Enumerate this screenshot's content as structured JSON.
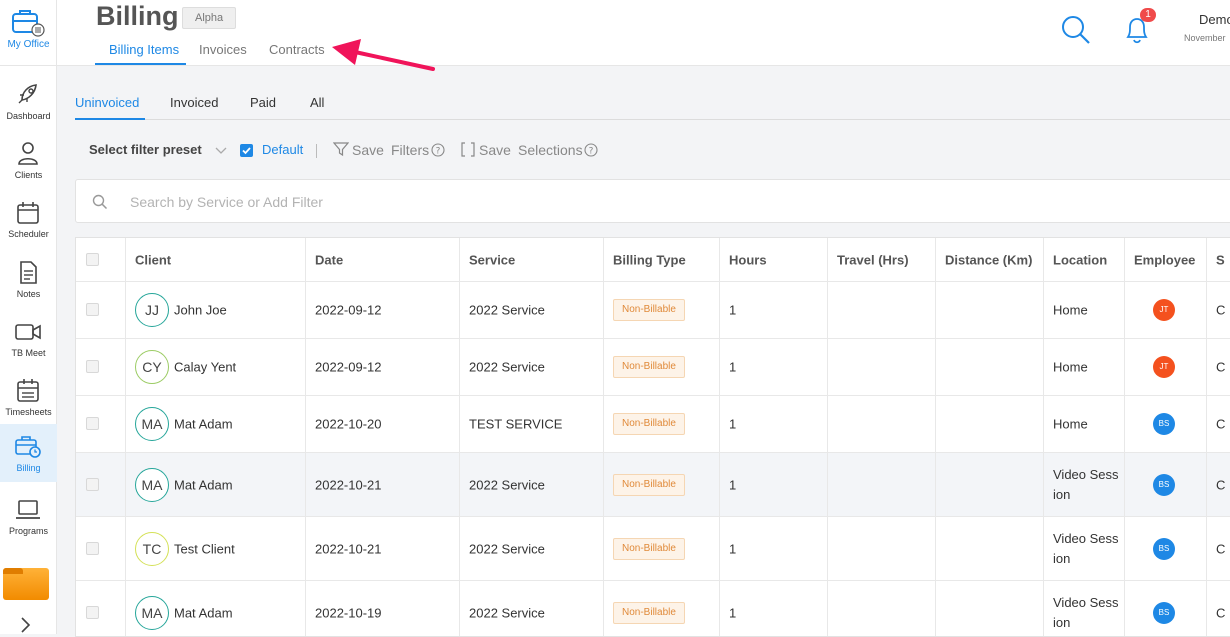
{
  "rail": {
    "office_label": "My Office",
    "items": [
      {
        "label": "Dashboard",
        "icon": "rocket-icon"
      },
      {
        "label": "Clients",
        "icon": "person-icon"
      },
      {
        "label": "Scheduler",
        "icon": "calendar-icon"
      },
      {
        "label": "Notes",
        "icon": "document-icon"
      },
      {
        "label": "TB Meet",
        "icon": "video-icon"
      },
      {
        "label": "Timesheets",
        "icon": "timesheet-icon"
      },
      {
        "label": "Billing",
        "icon": "billing-icon",
        "active": true
      },
      {
        "label": "Programs",
        "icon": "laptop-icon"
      }
    ]
  },
  "header": {
    "title": "Billing",
    "badge": "Alpha",
    "tabs": [
      {
        "label": "Billing Items",
        "active": true
      },
      {
        "label": "Invoices"
      },
      {
        "label": "Contracts"
      }
    ],
    "notification_count": "1",
    "user_name": "Demo",
    "user_sub": "November"
  },
  "subtabs": [
    {
      "label": "Uninvoiced",
      "active": true
    },
    {
      "label": "Invoiced"
    },
    {
      "label": "Paid"
    },
    {
      "label": "All"
    }
  ],
  "filters": {
    "preset_label": "Select filter preset",
    "default_label": "Default",
    "save_filters_a": "Save",
    "save_filters_b": "Filters",
    "save_selections_a": "Save",
    "save_selections_b": "Selections"
  },
  "search": {
    "placeholder": "Search by Service or Add Filter"
  },
  "table": {
    "columns": [
      "Client",
      "Date",
      "Service",
      "Billing Type",
      "Hours",
      "Travel (Hrs)",
      "Distance (Km)",
      "Location",
      "Employee",
      "S"
    ],
    "rows": [
      {
        "initials": "JJ",
        "client": "John Joe",
        "date": "2022-09-12",
        "service": "2022 Service",
        "billing_type": "Non-Billable",
        "hours": "1",
        "travel": "",
        "distance": "",
        "location": "Home",
        "employee": "JT",
        "status": "C"
      },
      {
        "initials": "CY",
        "client": "Calay Yent",
        "date": "2022-09-12",
        "service": "2022 Service",
        "billing_type": "Non-Billable",
        "hours": "1",
        "travel": "",
        "distance": "",
        "location": "Home",
        "employee": "JT",
        "status": "C"
      },
      {
        "initials": "MA",
        "client": "Mat Adam",
        "date": "2022-10-20",
        "service": "TEST SERVICE",
        "billing_type": "Non-Billable",
        "hours": "1",
        "travel": "",
        "distance": "",
        "location": "Home",
        "employee": "BS",
        "status": "C"
      },
      {
        "initials": "MA",
        "client": "Mat Adam",
        "date": "2022-10-21",
        "service": "2022 Service",
        "billing_type": "Non-Billable",
        "hours": "1",
        "travel": "",
        "distance": "",
        "location": "Video Session",
        "employee": "BS",
        "status": "C"
      },
      {
        "initials": "TC",
        "client": "Test Client",
        "date": "2022-10-21",
        "service": "2022 Service",
        "billing_type": "Non-Billable",
        "hours": "1",
        "travel": "",
        "distance": "",
        "location": "Video Session",
        "employee": "BS",
        "status": "C"
      },
      {
        "initials": "MA",
        "client": "Mat Adam",
        "date": "2022-10-19",
        "service": "2022 Service",
        "billing_type": "Non-Billable",
        "hours": "1",
        "travel": "",
        "distance": "",
        "location": "Video Session",
        "employee": "BS",
        "status": "C"
      }
    ]
  },
  "colors": {
    "accent": "#1e88e5",
    "arrow": "#f0145a",
    "employee_jt": "#f4511e",
    "employee_bs": "#1e88e5",
    "pill_text": "#e08a3a"
  }
}
